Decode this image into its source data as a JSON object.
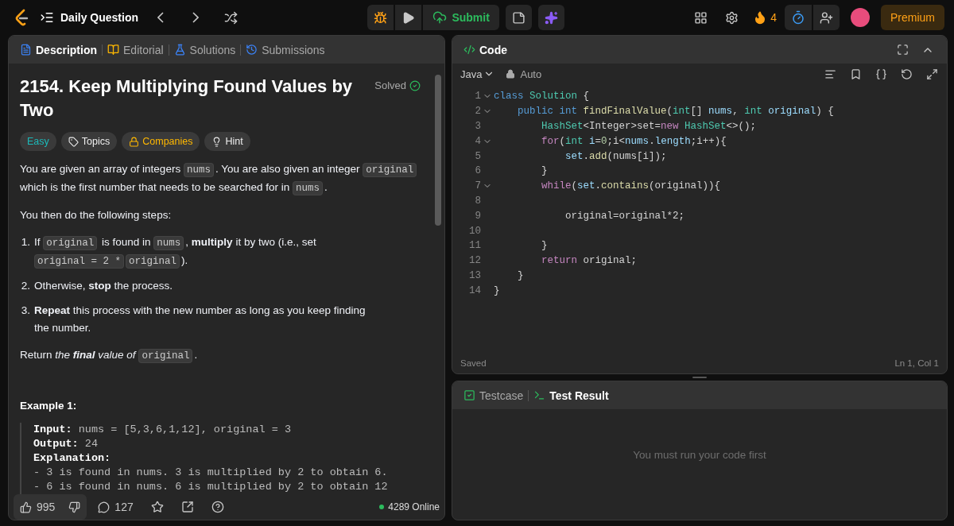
{
  "topbar": {
    "title": "Daily Question",
    "submit": "Submit",
    "streak": "4",
    "premium": "Premium"
  },
  "left_tabs": [
    {
      "label": "Description",
      "selected": true
    },
    {
      "label": "Editorial",
      "selected": false
    },
    {
      "label": "Solutions",
      "selected": false
    },
    {
      "label": "Submissions",
      "selected": false
    }
  ],
  "problem": {
    "title": "2154. Keep Multiplying Found Values by Two",
    "status": "Solved",
    "tags": [
      {
        "label": "Easy",
        "kind": "difficulty"
      },
      {
        "label": "Topics",
        "kind": "topics"
      },
      {
        "label": "Companies",
        "kind": "companies"
      },
      {
        "label": "Hint",
        "kind": "hint"
      }
    ],
    "intro": [
      {
        "text": "You are given an array of integers ",
        "kind": "plain"
      },
      {
        "text": "nums",
        "kind": "code"
      },
      {
        "text": ". You are also given an integer ",
        "kind": "plain"
      },
      {
        "text": "original",
        "kind": "code"
      },
      {
        "text": " which is the first number that needs to be searched for in ",
        "kind": "plain"
      },
      {
        "text": "nums",
        "kind": "code"
      },
      {
        "text": ".",
        "kind": "plain"
      }
    ],
    "steps_intro": "You then do the following steps:",
    "steps": [
      {
        "number": "1.",
        "segments": [
          {
            "text": "If ",
            "kind": "plain"
          },
          {
            "text": "original",
            "kind": "code"
          },
          {
            "text": " is found in ",
            "kind": "plain"
          },
          {
            "text": "nums",
            "kind": "code"
          },
          {
            "text": ", ",
            "kind": "plain"
          },
          {
            "text": "multiply",
            "kind": "bold"
          },
          {
            "text": " it by two (i.e., set ",
            "kind": "plain"
          },
          {
            "text": "original = 2 *",
            "kind": "code"
          },
          {
            "text": "original",
            "kind": "code"
          },
          {
            "text": ").",
            "kind": "plain"
          }
        ]
      },
      {
        "number": "2.",
        "segments": [
          {
            "text": "Otherwise, ",
            "kind": "plain"
          },
          {
            "text": "stop",
            "kind": "bold"
          },
          {
            "text": " the process.",
            "kind": "plain"
          }
        ]
      },
      {
        "number": "3.",
        "segments": [
          {
            "text": "Repeat",
            "kind": "bold"
          },
          {
            "text": " this process with the new number as long as you keep finding the number.",
            "kind": "plain"
          }
        ]
      }
    ],
    "return_text": [
      {
        "text": "Return ",
        "kind": "plain"
      },
      {
        "text": "the ",
        "kind": "italic"
      },
      {
        "text": "final",
        "kind": "bolditalic"
      },
      {
        "text": " value of ",
        "kind": "italic"
      },
      {
        "text": "original",
        "kind": "code"
      },
      {
        "text": ".",
        "kind": "plain"
      }
    ],
    "example": {
      "title": "Example 1:",
      "lines": [
        {
          "label": "Input:",
          "value": "nums = [5,3,6,1,12], original = 3"
        },
        {
          "label": "Output:",
          "value": "24"
        },
        {
          "label": "Explanation:"
        },
        {
          "value": "- 3 is found in nums. 3 is multiplied by 2 to obtain 6."
        },
        {
          "value": "- 6 is found in nums. 6 is multiplied by 2 to obtain 12"
        }
      ]
    }
  },
  "footer": {
    "likes": "995",
    "comments": "127",
    "online": "4289 Online"
  },
  "code_panel": {
    "title": "Code",
    "language": "Java",
    "mode": "Auto",
    "saved": "Saved",
    "cursor": "Ln 1, Col 1",
    "lines": [
      {
        "number": "1",
        "foldable": true,
        "tokens": [
          {
            "text": "class ",
            "kind": "kw"
          },
          {
            "text": "Solution",
            "kind": "type"
          },
          {
            "text": " {",
            "kind": "plain"
          }
        ]
      },
      {
        "number": "2",
        "foldable": true,
        "tokens": [
          {
            "text": "    public int ",
            "kind": "kw"
          },
          {
            "text": "findFinalValue",
            "kind": "fn"
          },
          {
            "text": "(",
            "kind": "plain"
          },
          {
            "text": "int",
            "kind": "type"
          },
          {
            "text": "[] ",
            "kind": "plain"
          },
          {
            "text": "nums",
            "kind": "var"
          },
          {
            "text": ", ",
            "kind": "plain"
          },
          {
            "text": "int ",
            "kind": "type"
          },
          {
            "text": "original",
            "kind": "var"
          },
          {
            "text": ") {",
            "kind": "plain"
          }
        ]
      },
      {
        "number": "3",
        "foldable": false,
        "tokens": [
          {
            "text": "        HashSet",
            "kind": "type"
          },
          {
            "text": "<Integer>set=",
            "kind": "plain"
          },
          {
            "text": "new ",
            "kind": "ctrl"
          },
          {
            "text": "HashSet",
            "kind": "type"
          },
          {
            "text": "<>();",
            "kind": "plain"
          }
        ]
      },
      {
        "number": "4",
        "foldable": true,
        "tokens": [
          {
            "text": "        for",
            "kind": "ctrl"
          },
          {
            "text": "(",
            "kind": "plain"
          },
          {
            "text": "int ",
            "kind": "type"
          },
          {
            "text": "i",
            "kind": "var"
          },
          {
            "text": "=",
            "kind": "plain"
          },
          {
            "text": "0",
            "kind": "num"
          },
          {
            "text": ";i<",
            "kind": "plain"
          },
          {
            "text": "nums",
            "kind": "var"
          },
          {
            "text": ".",
            "kind": "plain"
          },
          {
            "text": "length",
            "kind": "var"
          },
          {
            "text": ";i++){",
            "kind": "plain"
          }
        ]
      },
      {
        "number": "5",
        "foldable": false,
        "tokens": [
          {
            "text": "            set",
            "kind": "var"
          },
          {
            "text": ".",
            "kind": "plain"
          },
          {
            "text": "add",
            "kind": "fn"
          },
          {
            "text": "(nums[i]);",
            "kind": "plain"
          }
        ]
      },
      {
        "number": "6",
        "foldable": false,
        "tokens": [
          {
            "text": "        }",
            "kind": "plain"
          }
        ]
      },
      {
        "number": "7",
        "foldable": true,
        "tokens": [
          {
            "text": "        while",
            "kind": "ctrl"
          },
          {
            "text": "(",
            "kind": "plain"
          },
          {
            "text": "set",
            "kind": "var"
          },
          {
            "text": ".",
            "kind": "plain"
          },
          {
            "text": "contains",
            "kind": "fn"
          },
          {
            "text": "(original)){",
            "kind": "plain"
          }
        ]
      },
      {
        "number": "8",
        "foldable": false
      },
      {
        "number": "9",
        "foldable": false,
        "tokens": [
          {
            "text": "            original=original*2;",
            "kind": "plain"
          }
        ]
      },
      {
        "number": "10",
        "foldable": false
      },
      {
        "number": "11",
        "foldable": false,
        "tokens": [
          {
            "text": "        }",
            "kind": "plain"
          }
        ]
      },
      {
        "number": "12",
        "foldable": false,
        "tokens": [
          {
            "text": "        return",
            "kind": "ctrl"
          },
          {
            "text": " original;",
            "kind": "plain"
          }
        ]
      },
      {
        "number": "13",
        "foldable": false,
        "tokens": [
          {
            "text": "    }",
            "kind": "plain"
          }
        ]
      },
      {
        "number": "14",
        "foldable": false,
        "tokens": [
          {
            "text": "}",
            "kind": "plain"
          }
        ]
      }
    ]
  },
  "result_panel": {
    "tabs": [
      {
        "label": "Testcase",
        "selected": false
      },
      {
        "label": "Test Result",
        "selected": true
      }
    ],
    "message": "You must run your code first"
  }
}
